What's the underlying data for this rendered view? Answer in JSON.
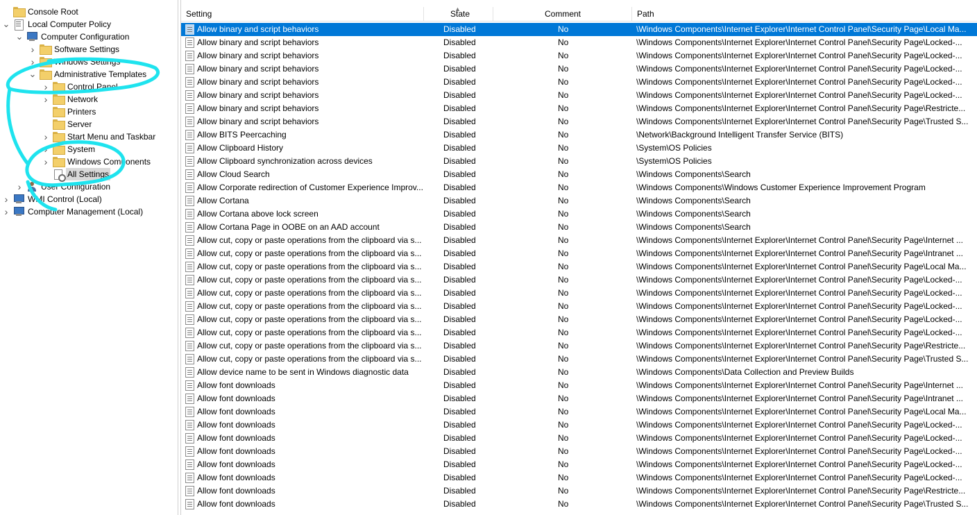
{
  "tree": {
    "items": [
      {
        "label": "Console Root",
        "icon": "folder-icon",
        "expander": "",
        "depth": 0
      },
      {
        "label": "Local Computer Policy",
        "icon": "policy-icon",
        "expander": "chevron-down",
        "depth": 0
      },
      {
        "label": "Computer Configuration",
        "icon": "computer-icon",
        "expander": "chevron-down",
        "depth": 1
      },
      {
        "label": "Software Settings",
        "icon": "folder-icon",
        "expander": "chevron-right",
        "depth": 2
      },
      {
        "label": "Windows Settings",
        "icon": "folder-icon",
        "expander": "chevron-right",
        "depth": 2
      },
      {
        "label": "Administrative Templates",
        "icon": "folder-icon",
        "expander": "chevron-down",
        "depth": 2
      },
      {
        "label": "Control Panel",
        "icon": "folder-icon",
        "expander": "chevron-right",
        "depth": 3
      },
      {
        "label": "Network",
        "icon": "folder-icon",
        "expander": "chevron-right",
        "depth": 3
      },
      {
        "label": "Printers",
        "icon": "folder-icon",
        "expander": "",
        "depth": 3
      },
      {
        "label": "Server",
        "icon": "folder-icon",
        "expander": "",
        "depth": 3
      },
      {
        "label": "Start Menu and Taskbar",
        "icon": "folder-icon",
        "expander": "chevron-right",
        "depth": 3
      },
      {
        "label": "System",
        "icon": "folder-icon",
        "expander": "chevron-right",
        "depth": 3
      },
      {
        "label": "Windows Components",
        "icon": "folder-icon",
        "expander": "chevron-right",
        "depth": 3
      },
      {
        "label": "All Settings",
        "icon": "allsettings-icon",
        "expander": "",
        "depth": 3,
        "selected": true
      },
      {
        "label": "User Configuration",
        "icon": "user-icon",
        "expander": "chevron-right",
        "depth": 1
      },
      {
        "label": "WMI Control (Local)",
        "icon": "computer-icon",
        "expander": "chevron-right",
        "depth": 0
      },
      {
        "label": "Computer Management (Local)",
        "icon": "computer-icon",
        "expander": "chevron-right",
        "depth": 0
      }
    ]
  },
  "list": {
    "columns": {
      "setting": "Setting",
      "state": "State",
      "comment": "Comment",
      "path": "Path"
    },
    "selection_color": "#0078d7",
    "rows": [
      {
        "setting": "Allow binary and script behaviors",
        "state": "Disabled",
        "comment": "No",
        "path": "\\Windows Components\\Internet Explorer\\Internet Control Panel\\Security Page\\Local Ma..."
      },
      {
        "setting": "Allow binary and script behaviors",
        "state": "Disabled",
        "comment": "No",
        "path": "\\Windows Components\\Internet Explorer\\Internet Control Panel\\Security Page\\Locked-..."
      },
      {
        "setting": "Allow binary and script behaviors",
        "state": "Disabled",
        "comment": "No",
        "path": "\\Windows Components\\Internet Explorer\\Internet Control Panel\\Security Page\\Locked-..."
      },
      {
        "setting": "Allow binary and script behaviors",
        "state": "Disabled",
        "comment": "No",
        "path": "\\Windows Components\\Internet Explorer\\Internet Control Panel\\Security Page\\Locked-..."
      },
      {
        "setting": "Allow binary and script behaviors",
        "state": "Disabled",
        "comment": "No",
        "path": "\\Windows Components\\Internet Explorer\\Internet Control Panel\\Security Page\\Locked-..."
      },
      {
        "setting": "Allow binary and script behaviors",
        "state": "Disabled",
        "comment": "No",
        "path": "\\Windows Components\\Internet Explorer\\Internet Control Panel\\Security Page\\Locked-..."
      },
      {
        "setting": "Allow binary and script behaviors",
        "state": "Disabled",
        "comment": "No",
        "path": "\\Windows Components\\Internet Explorer\\Internet Control Panel\\Security Page\\Restricte..."
      },
      {
        "setting": "Allow binary and script behaviors",
        "state": "Disabled",
        "comment": "No",
        "path": "\\Windows Components\\Internet Explorer\\Internet Control Panel\\Security Page\\Trusted S..."
      },
      {
        "setting": "Allow BITS Peercaching",
        "state": "Disabled",
        "comment": "No",
        "path": "\\Network\\Background Intelligent Transfer Service (BITS)"
      },
      {
        "setting": "Allow Clipboard History",
        "state": "Disabled",
        "comment": "No",
        "path": "\\System\\OS Policies"
      },
      {
        "setting": "Allow Clipboard synchronization across devices",
        "state": "Disabled",
        "comment": "No",
        "path": "\\System\\OS Policies"
      },
      {
        "setting": "Allow Cloud Search",
        "state": "Disabled",
        "comment": "No",
        "path": "\\Windows Components\\Search"
      },
      {
        "setting": "Allow Corporate redirection of Customer Experience Improv...",
        "state": "Disabled",
        "comment": "No",
        "path": "\\Windows Components\\Windows Customer Experience Improvement Program"
      },
      {
        "setting": "Allow Cortana",
        "state": "Disabled",
        "comment": "No",
        "path": "\\Windows Components\\Search"
      },
      {
        "setting": "Allow Cortana above lock screen",
        "state": "Disabled",
        "comment": "No",
        "path": "\\Windows Components\\Search"
      },
      {
        "setting": "Allow Cortana Page in OOBE on an AAD account",
        "state": "Disabled",
        "comment": "No",
        "path": "\\Windows Components\\Search"
      },
      {
        "setting": "Allow cut, copy or paste operations from the clipboard via s...",
        "state": "Disabled",
        "comment": "No",
        "path": "\\Windows Components\\Internet Explorer\\Internet Control Panel\\Security Page\\Internet ..."
      },
      {
        "setting": "Allow cut, copy or paste operations from the clipboard via s...",
        "state": "Disabled",
        "comment": "No",
        "path": "\\Windows Components\\Internet Explorer\\Internet Control Panel\\Security Page\\Intranet ..."
      },
      {
        "setting": "Allow cut, copy or paste operations from the clipboard via s...",
        "state": "Disabled",
        "comment": "No",
        "path": "\\Windows Components\\Internet Explorer\\Internet Control Panel\\Security Page\\Local Ma..."
      },
      {
        "setting": "Allow cut, copy or paste operations from the clipboard via s...",
        "state": "Disabled",
        "comment": "No",
        "path": "\\Windows Components\\Internet Explorer\\Internet Control Panel\\Security Page\\Locked-..."
      },
      {
        "setting": "Allow cut, copy or paste operations from the clipboard via s...",
        "state": "Disabled",
        "comment": "No",
        "path": "\\Windows Components\\Internet Explorer\\Internet Control Panel\\Security Page\\Locked-..."
      },
      {
        "setting": "Allow cut, copy or paste operations from the clipboard via s...",
        "state": "Disabled",
        "comment": "No",
        "path": "\\Windows Components\\Internet Explorer\\Internet Control Panel\\Security Page\\Locked-..."
      },
      {
        "setting": "Allow cut, copy or paste operations from the clipboard via s...",
        "state": "Disabled",
        "comment": "No",
        "path": "\\Windows Components\\Internet Explorer\\Internet Control Panel\\Security Page\\Locked-..."
      },
      {
        "setting": "Allow cut, copy or paste operations from the clipboard via s...",
        "state": "Disabled",
        "comment": "No",
        "path": "\\Windows Components\\Internet Explorer\\Internet Control Panel\\Security Page\\Locked-..."
      },
      {
        "setting": "Allow cut, copy or paste operations from the clipboard via s...",
        "state": "Disabled",
        "comment": "No",
        "path": "\\Windows Components\\Internet Explorer\\Internet Control Panel\\Security Page\\Restricte..."
      },
      {
        "setting": "Allow cut, copy or paste operations from the clipboard via s...",
        "state": "Disabled",
        "comment": "No",
        "path": "\\Windows Components\\Internet Explorer\\Internet Control Panel\\Security Page\\Trusted S..."
      },
      {
        "setting": "Allow device name to be sent in Windows diagnostic data",
        "state": "Disabled",
        "comment": "No",
        "path": "\\Windows Components\\Data Collection and Preview Builds"
      },
      {
        "setting": "Allow font downloads",
        "state": "Disabled",
        "comment": "No",
        "path": "\\Windows Components\\Internet Explorer\\Internet Control Panel\\Security Page\\Internet ..."
      },
      {
        "setting": "Allow font downloads",
        "state": "Disabled",
        "comment": "No",
        "path": "\\Windows Components\\Internet Explorer\\Internet Control Panel\\Security Page\\Intranet ..."
      },
      {
        "setting": "Allow font downloads",
        "state": "Disabled",
        "comment": "No",
        "path": "\\Windows Components\\Internet Explorer\\Internet Control Panel\\Security Page\\Local Ma..."
      },
      {
        "setting": "Allow font downloads",
        "state": "Disabled",
        "comment": "No",
        "path": "\\Windows Components\\Internet Explorer\\Internet Control Panel\\Security Page\\Locked-..."
      },
      {
        "setting": "Allow font downloads",
        "state": "Disabled",
        "comment": "No",
        "path": "\\Windows Components\\Internet Explorer\\Internet Control Panel\\Security Page\\Locked-..."
      },
      {
        "setting": "Allow font downloads",
        "state": "Disabled",
        "comment": "No",
        "path": "\\Windows Components\\Internet Explorer\\Internet Control Panel\\Security Page\\Locked-..."
      },
      {
        "setting": "Allow font downloads",
        "state": "Disabled",
        "comment": "No",
        "path": "\\Windows Components\\Internet Explorer\\Internet Control Panel\\Security Page\\Locked-..."
      },
      {
        "setting": "Allow font downloads",
        "state": "Disabled",
        "comment": "No",
        "path": "\\Windows Components\\Internet Explorer\\Internet Control Panel\\Security Page\\Locked-..."
      },
      {
        "setting": "Allow font downloads",
        "state": "Disabled",
        "comment": "No",
        "path": "\\Windows Components\\Internet Explorer\\Internet Control Panel\\Security Page\\Restricte..."
      },
      {
        "setting": "Allow font downloads",
        "state": "Disabled",
        "comment": "No",
        "path": "\\Windows Components\\Internet Explorer\\Internet Control Panel\\Security Page\\Trusted S..."
      }
    ]
  }
}
